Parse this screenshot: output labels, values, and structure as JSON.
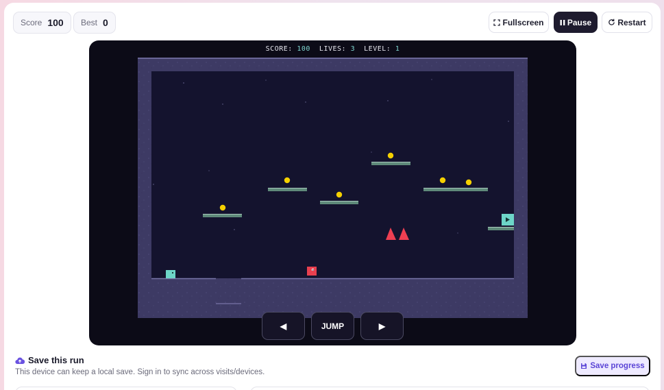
{
  "stats": {
    "score_label": "Score",
    "score_value": "100",
    "best_label": "Best",
    "best_value": "0"
  },
  "toolbar": {
    "fullscreen_label": "Fullscreen",
    "pause_label": "Pause",
    "restart_label": "Restart"
  },
  "hud": {
    "score_label": "SCORE:",
    "score_value": "100",
    "lives_label": "LIVES:",
    "lives_value": "3",
    "level_label": "LEVEL:",
    "level_value": "1"
  },
  "controls": {
    "left_label": "◀",
    "jump_label": "JUMP",
    "right_label": "▶"
  },
  "save": {
    "title": "Save this run",
    "subtitle": "This device can keep a local save. Sign in to sync across visits/devices.",
    "button_label": "Save progress"
  },
  "colors": {
    "accent": "#5b45d6",
    "game_bg": "#14132e",
    "wall": "#3d3a64",
    "platform": "#5f8a7a",
    "coin": "#f5d000",
    "spike": "#ee3f52",
    "player": "#e8404f",
    "checkpoint": "#6dd5c8"
  },
  "icons": [
    "fullscreen-icon",
    "pause-icon",
    "restart-icon",
    "cloud-upload-icon",
    "save-icon"
  ]
}
